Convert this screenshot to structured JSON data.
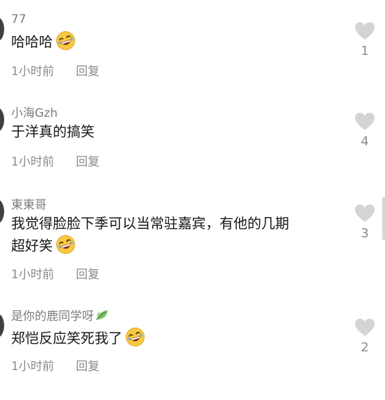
{
  "comments": [
    {
      "username": "77",
      "text": "哈哈哈",
      "emoji": "rofl-emoji",
      "time": "1小时前",
      "reply_label": "回复",
      "likes": "1",
      "badge": null
    },
    {
      "username": "小海Gzh",
      "text": "于洋真的搞笑",
      "emoji": null,
      "time": "1小时前",
      "reply_label": "回复",
      "likes": "4",
      "badge": null
    },
    {
      "username": "東東哥",
      "text_line1": "我觉得脸脸下季可以当常驻嘉宾，有他的几期",
      "text_line2": "超好笑",
      "emoji": "rofl-emoji",
      "time": "1小时前",
      "reply_label": "回复",
      "likes": "3",
      "badge": null
    },
    {
      "username": "是你的鹿同学呀",
      "text": "郑恺反应笑死我了",
      "emoji": "rofl-emoji",
      "time": "1小时前",
      "reply_label": "回复",
      "likes": "2",
      "badge": "leaf-icon"
    }
  ],
  "icons": {
    "like": "heart-icon",
    "emoji": "rofl-emoji"
  },
  "colors": {
    "username": "#7d7d82",
    "text": "#161616",
    "meta": "#8a8a8f",
    "heart": "#d4d4d4",
    "background": "#ffffff"
  }
}
